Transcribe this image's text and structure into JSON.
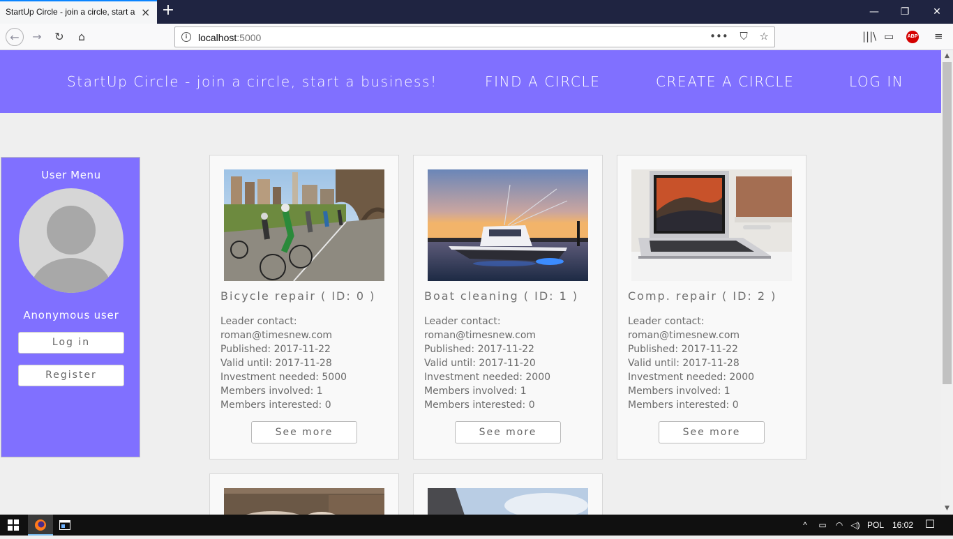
{
  "browser": {
    "tab_title": "StartUp Circle - join a circle, start a business!",
    "tab_close": "×",
    "new_tab": "+",
    "window_controls": {
      "minimize": "—",
      "restore": "❐",
      "close": "✕"
    },
    "url_host": "localhost",
    "url_port": ":5000",
    "url_info": "i",
    "url_actions": [
      "•••",
      "⛉",
      "☆"
    ],
    "nav_icons": {
      "back": "←",
      "forward": "→",
      "reload": "↻",
      "home": "⌂"
    },
    "toolbar_icons": [
      "|||\\",
      "▭",
      "≡"
    ],
    "abp_label": "ABP"
  },
  "header": {
    "brand": "StartUp Circle - join a circle, start a business!",
    "links": [
      "FIND A CIRCLE",
      "CREATE A CIRCLE",
      "LOG IN"
    ]
  },
  "user_menu": {
    "title": "User Menu",
    "username": "Anonymous user",
    "login_label": "Log in",
    "register_label": "Register"
  },
  "circles": [
    {
      "title": "Bicycle repair ( ID: 0 )",
      "leader_label": "Leader contact:",
      "leader_email": "roman@timesnew.com",
      "published": "Published: 2017-11-22",
      "valid_until": "Valid until: 2017-11-28",
      "investment": "Investment needed: 5000",
      "members_involved": "Members involved: 1",
      "members_interested": "Members interested: 0",
      "more_label": "See more"
    },
    {
      "title": "Boat cleaning ( ID: 1 )",
      "leader_label": "Leader contact:",
      "leader_email": "roman@timesnew.com",
      "published": "Published: 2017-11-22",
      "valid_until": "Valid until: 2017-11-20",
      "investment": "Investment needed: 2000",
      "members_involved": "Members involved: 1",
      "members_interested": "Members interested: 0",
      "more_label": "See more"
    },
    {
      "title": "Comp. repair ( ID: 2 )",
      "leader_label": "Leader contact:",
      "leader_email": "roman@timesnew.com",
      "published": "Published: 2017-11-22",
      "valid_until": "Valid until: 2017-11-28",
      "investment": "Investment needed: 2000",
      "members_involved": "Members involved: 1",
      "members_interested": "Members interested: 0",
      "more_label": "See more"
    }
  ],
  "taskbar": {
    "language": "POL",
    "time": "16:02",
    "tray_icons": [
      "^",
      "▭",
      "◠",
      "◁)",
      "☐"
    ]
  },
  "colors": {
    "brand": "#8070ff",
    "page_bg": "#efefef",
    "card_bg": "#f9f9f9"
  }
}
